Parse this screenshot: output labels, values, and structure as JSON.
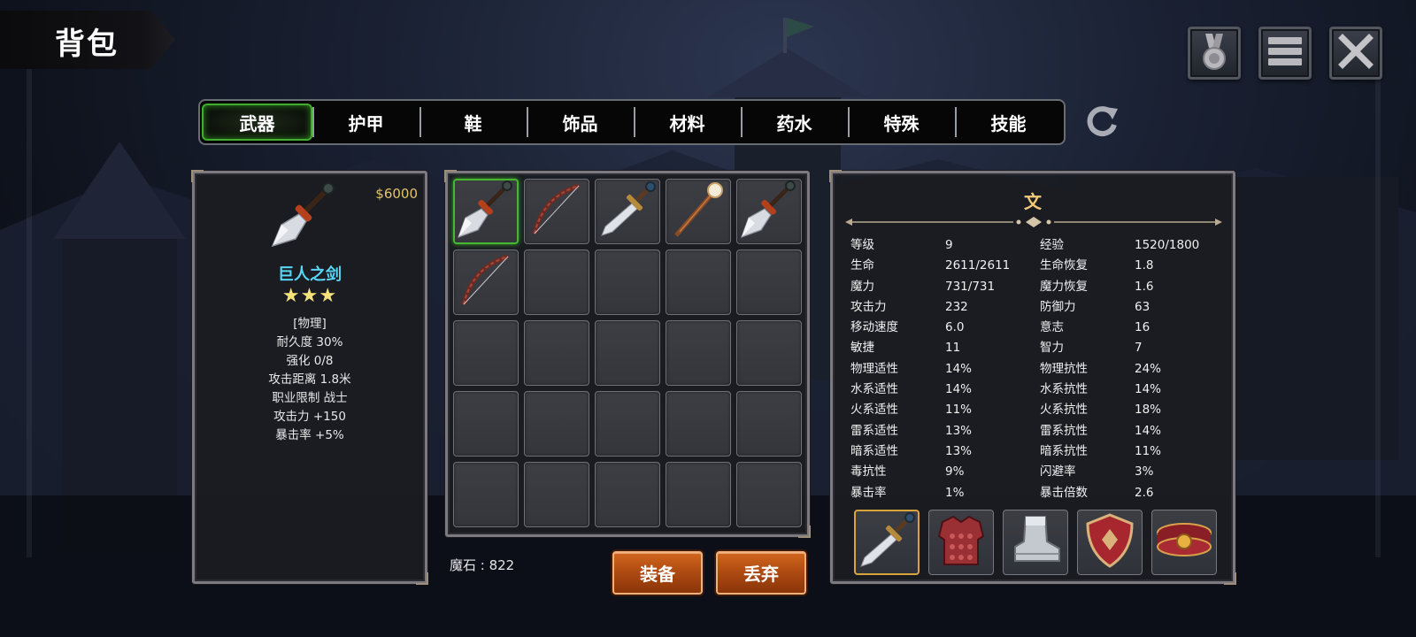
{
  "header": {
    "title": "背包"
  },
  "top_buttons": [
    {
      "name": "medal-icon"
    },
    {
      "name": "menu-icon"
    },
    {
      "name": "close-icon"
    }
  ],
  "tabs": [
    {
      "label": "武器",
      "active": true
    },
    {
      "label": "护甲",
      "active": false
    },
    {
      "label": "鞋",
      "active": false
    },
    {
      "label": "饰品",
      "active": false
    },
    {
      "label": "材料",
      "active": false
    },
    {
      "label": "药水",
      "active": false
    },
    {
      "label": "特殊",
      "active": false
    },
    {
      "label": "技能",
      "active": false
    }
  ],
  "item": {
    "price": "$6000",
    "icon": "sword-icon",
    "name": "巨人之剑",
    "stars": "★★★",
    "lines": [
      "[物理]",
      "耐久度 30%",
      "强化 0/8",
      "攻击距离  1.8米",
      "职业限制  战士",
      "攻击力  +150",
      "暴击率  +5%"
    ]
  },
  "inventory": {
    "slots": [
      "sword",
      "bow",
      "dagger",
      "staff",
      "sword",
      "bow",
      "",
      "",
      "",
      "",
      "",
      "",
      "",
      "",
      "",
      "",
      "",
      "",
      "",
      "",
      "",
      "",
      "",
      "",
      ""
    ],
    "selected_index": 0
  },
  "footer": {
    "magic_stone": "魔石 : 822",
    "equip_label": "装备",
    "discard_label": "丢弃"
  },
  "character": {
    "name": "文",
    "stats": [
      [
        "等级",
        "9",
        "经验",
        "1520/1800"
      ],
      [
        "生命",
        "2611/2611",
        "生命恢复",
        "1.8"
      ],
      [
        "魔力",
        "731/731",
        "魔力恢复",
        "1.6"
      ],
      [
        "攻击力",
        "232",
        "防御力",
        "63"
      ],
      [
        "移动速度",
        "6.0",
        "意志",
        "16"
      ],
      [
        "敏捷",
        "11",
        "智力",
        "7"
      ],
      [
        "物理适性",
        "14%",
        "物理抗性",
        "24%"
      ],
      [
        "水系适性",
        "14%",
        "水系抗性",
        "14%"
      ],
      [
        "火系适性",
        "11%",
        "火系抗性",
        "18%"
      ],
      [
        "雷系适性",
        "13%",
        "雷系抗性",
        "14%"
      ],
      [
        "暗系适性",
        "13%",
        "暗系抗性",
        "11%"
      ],
      [
        "毒抗性",
        "9%",
        "闪避率",
        "3%"
      ],
      [
        "暴击率",
        "1%",
        "暴击倍数",
        "2.6"
      ]
    ],
    "equipment": [
      "dagger",
      "armor",
      "boots",
      "shield",
      "belt"
    ]
  },
  "colors": {
    "accent_green": "#3fae2c",
    "item_name": "#5ad6f5",
    "price_gold": "#e3c36b",
    "button_orange": "#c05a16"
  }
}
